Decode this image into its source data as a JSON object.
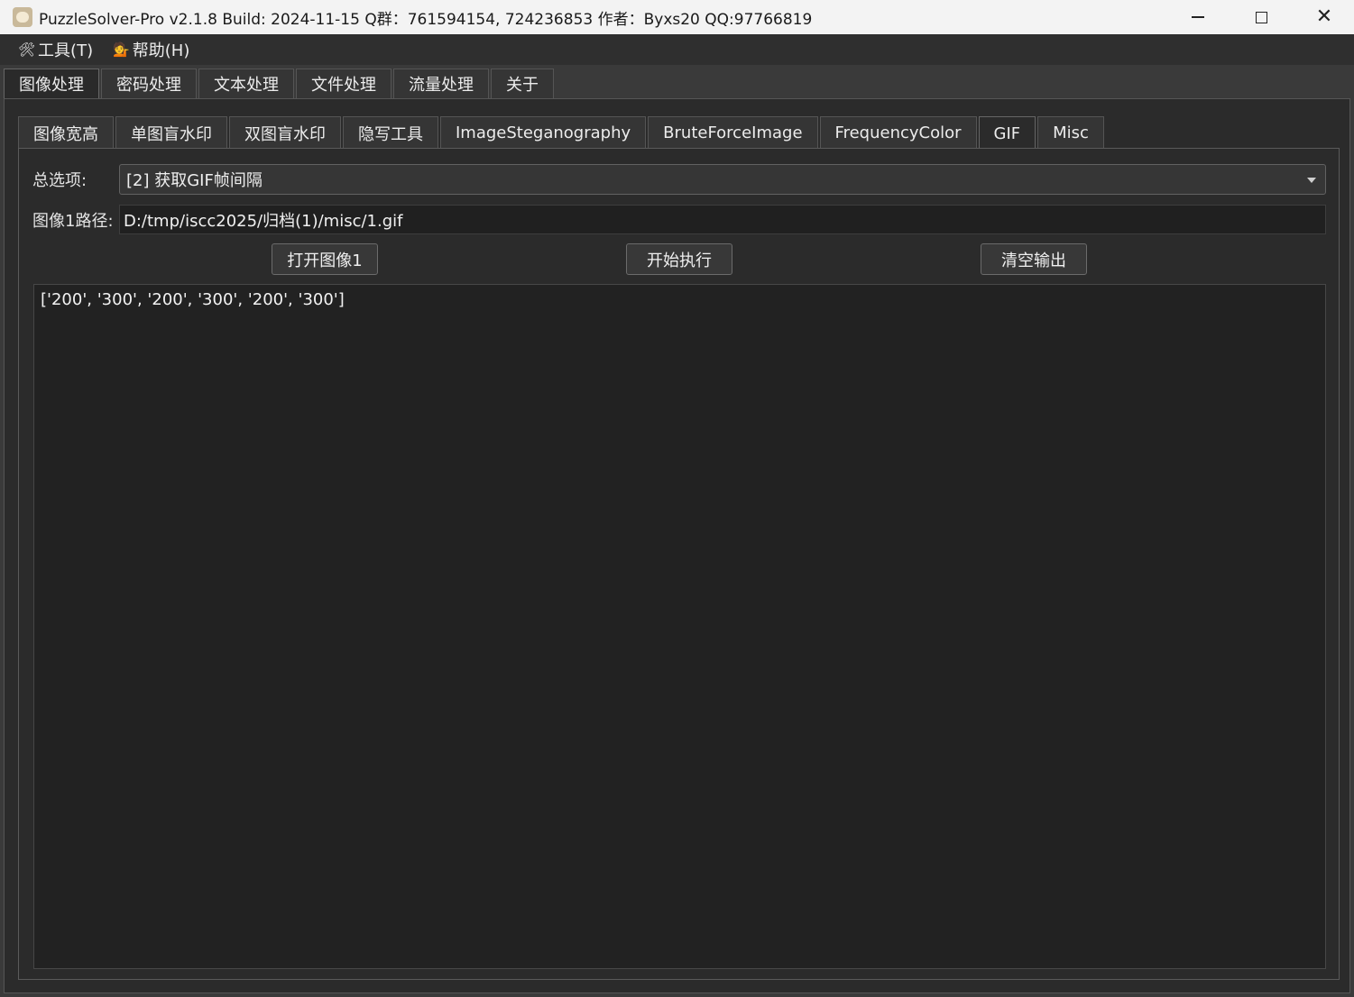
{
  "window": {
    "title": "PuzzleSolver-Pro v2.1.8  Build: 2024-11-15  Q群：761594154, 724236853  作者：Byxs20  QQ:97766819",
    "icon": "sheep-app-icon"
  },
  "menu": {
    "items": [
      {
        "label": "工具(T)",
        "icon": "🛠"
      },
      {
        "label": "帮助(H)",
        "icon": "💁"
      }
    ]
  },
  "main_tabs": [
    {
      "label": "图像处理",
      "active": true
    },
    {
      "label": "密码处理",
      "active": false
    },
    {
      "label": "文本处理",
      "active": false
    },
    {
      "label": "文件处理",
      "active": false
    },
    {
      "label": "流量处理",
      "active": false
    },
    {
      "label": "关于",
      "active": false
    }
  ],
  "sub_tabs": [
    {
      "label": "图像宽高",
      "active": false
    },
    {
      "label": "单图盲水印",
      "active": false
    },
    {
      "label": "双图盲水印",
      "active": false
    },
    {
      "label": "隐写工具",
      "active": false
    },
    {
      "label": "ImageSteganography",
      "active": false
    },
    {
      "label": "BruteForceImage",
      "active": false
    },
    {
      "label": "FrequencyColor",
      "active": false
    },
    {
      "label": "GIF",
      "active": true
    },
    {
      "label": "Misc",
      "active": false
    }
  ],
  "form": {
    "option_label": "总选项:",
    "option_value": "[2] 获取GIF帧间隔",
    "path_label": "图像1路径:",
    "path_value": "D:/tmp/iscc2025/归档(1)/misc/1.gif"
  },
  "buttons": {
    "open": "打开图像1",
    "run": "开始执行",
    "clear": "清空输出"
  },
  "output": {
    "text": "['200', '300', '200', '300', '200', '300']"
  },
  "colors": {
    "background": "#2b2b2b",
    "titlebar": "#f3f3f3",
    "output_bg": "#222222"
  }
}
